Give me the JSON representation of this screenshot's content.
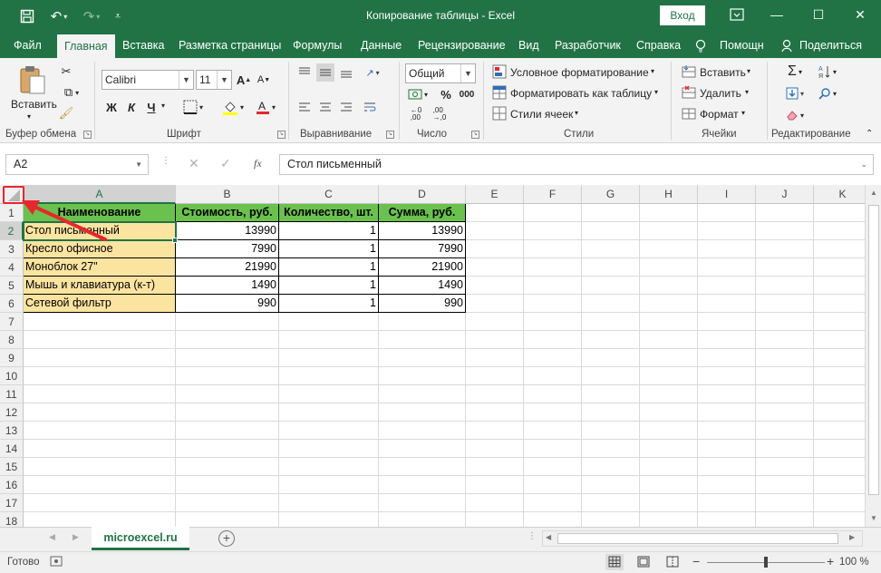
{
  "titlebar": {
    "title": "Копирование таблицы  -  Excel",
    "login_label": "Вход",
    "save_icon": "save-icon",
    "undo_icon": "undo-icon",
    "redo_icon": "redo-icon",
    "customize_icon": "customize-icon",
    "options_icon": "ribbon-display-icon",
    "minimize": "—",
    "maximize": "☐",
    "close": "✕"
  },
  "tabs": [
    {
      "label": "Файл"
    },
    {
      "label": "Главная"
    },
    {
      "label": "Вставка"
    },
    {
      "label": "Разметка страницы"
    },
    {
      "label": "Формулы"
    },
    {
      "label": "Данные"
    },
    {
      "label": "Рецензирование"
    },
    {
      "label": "Вид"
    },
    {
      "label": "Разработчик"
    },
    {
      "label": "Справка"
    },
    {
      "label": "Помощн"
    },
    {
      "label": "Поделиться"
    }
  ],
  "ribbon": {
    "clipboard": {
      "paste_label": "Вставить",
      "group_label": "Буфер обмена"
    },
    "font": {
      "font_name": "Calibri",
      "font_size": "11",
      "bold": "Ж",
      "italic": "К",
      "underline": "Ч",
      "group_label": "Шрифт"
    },
    "alignment": {
      "group_label": "Выравнивание"
    },
    "number": {
      "format": "Общий",
      "group_label": "Число"
    },
    "styles": {
      "conditional": "Условное форматирование",
      "format_table": "Форматировать как таблицу",
      "cell_styles": "Стили ячеек",
      "group_label": "Стили"
    },
    "cells": {
      "insert": "Вставить",
      "delete": "Удалить",
      "format": "Формат",
      "group_label": "Ячейки"
    },
    "editing": {
      "group_label": "Редактирование"
    }
  },
  "formula_bar": {
    "name_box": "A2",
    "fx": "fx",
    "content": "Стол письменный"
  },
  "columns": [
    "A",
    "B",
    "C",
    "D",
    "E",
    "F",
    "G",
    "H",
    "I",
    "J",
    "K"
  ],
  "rows": [
    "1",
    "2",
    "3",
    "4",
    "5",
    "6",
    "7",
    "8",
    "9",
    "10",
    "11",
    "12",
    "13",
    "14",
    "15",
    "16",
    "17",
    "18"
  ],
  "table": {
    "headers": [
      "Наименование",
      "Стоимость, руб.",
      "Количество, шт.",
      "Сумма, руб."
    ],
    "rows": [
      [
        "Стол письменный",
        "13990",
        "1",
        "13990"
      ],
      [
        "Кресло офисное",
        "7990",
        "1",
        "7990"
      ],
      [
        "Моноблок 27\"",
        "21990",
        "1",
        "21900"
      ],
      [
        "Мышь и клавиатура (к-т)",
        "1490",
        "1",
        "1490"
      ],
      [
        "Сетевой фильтр",
        "990",
        "1",
        "990"
      ]
    ]
  },
  "sheet_tabs": [
    {
      "label": "microexcel.ru"
    }
  ],
  "status": {
    "ready": "Готово",
    "zoom": "100 %"
  },
  "colors": {
    "accent": "#217346",
    "header_fill": "#6ac14d",
    "name_fill": "#fbe4a0",
    "annotation": "#e8262d"
  }
}
